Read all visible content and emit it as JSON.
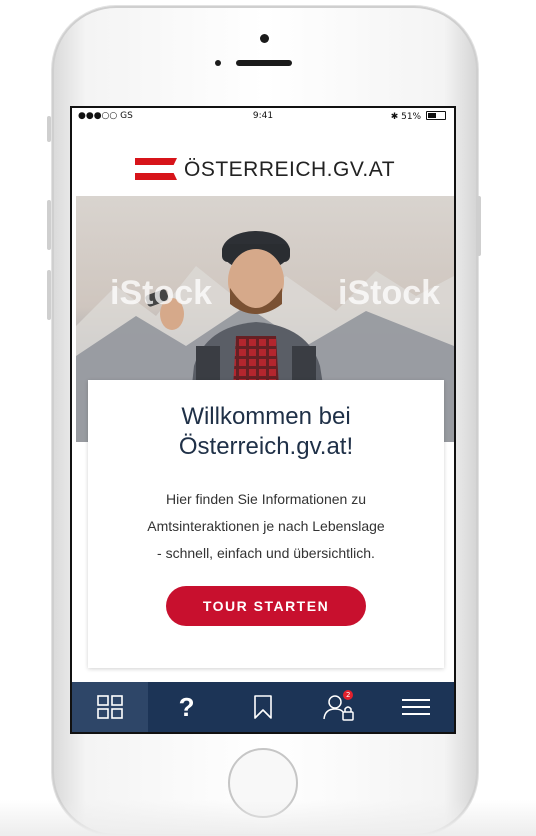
{
  "status_bar": {
    "carrier": "●●●○○ GS",
    "time": "9:41",
    "battery": "51%",
    "bluetooth": "✱"
  },
  "header": {
    "logo_text": "ÖSTERREICH.GV.AT",
    "flag_colors": [
      "#d7141a",
      "#ffffff",
      "#d7141a"
    ]
  },
  "hero": {
    "watermark": "iStock"
  },
  "welcome_card": {
    "title_line1": "Willkommen bei",
    "title_line2": "Österreich.gv.at!",
    "body_line1": "Hier finden Sie Informationen zu",
    "body_line2": "Amtsinteraktionen je nach Lebenslage",
    "body_line3": "- schnell, einfach und übersichtlich.",
    "button_label": "TOUR STARTEN"
  },
  "tab_bar": {
    "items": [
      {
        "icon": "grid-icon",
        "active": true
      },
      {
        "icon": "question-icon",
        "label": "?"
      },
      {
        "icon": "bookmark-icon"
      },
      {
        "icon": "user-lock-icon",
        "badge": "2"
      },
      {
        "icon": "menu-icon"
      }
    ]
  },
  "colors": {
    "brand_red": "#c8102e",
    "navy": "#1c3456",
    "title_navy": "#1f3047"
  }
}
